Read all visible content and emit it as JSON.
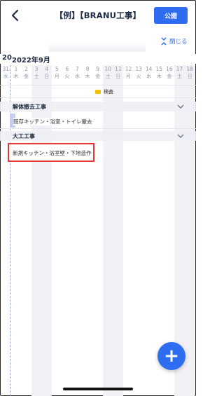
{
  "header": {
    "title": "【例】【BRANU工事】",
    "publish_label": "公開",
    "close_label": "閉じる"
  },
  "calendar": {
    "prev_month_fragment": "20",
    "month_label": "2022年9月",
    "days": [
      {
        "num": "31",
        "wd": "水"
      },
      {
        "num": "1",
        "wd": "木"
      },
      {
        "num": "2",
        "wd": "金"
      },
      {
        "num": "3",
        "wd": "土"
      },
      {
        "num": "4",
        "wd": "日"
      },
      {
        "num": "5",
        "wd": "月"
      },
      {
        "num": "6",
        "wd": "火"
      },
      {
        "num": "7",
        "wd": "水"
      },
      {
        "num": "8",
        "wd": "木"
      },
      {
        "num": "9",
        "wd": "金"
      },
      {
        "num": "10",
        "wd": "土"
      },
      {
        "num": "11",
        "wd": "日"
      },
      {
        "num": "12",
        "wd": "月"
      },
      {
        "num": "13",
        "wd": "火"
      },
      {
        "num": "14",
        "wd": "水"
      },
      {
        "num": "15",
        "wd": "木"
      },
      {
        "num": "16",
        "wd": "金"
      },
      {
        "num": "17",
        "wd": "土"
      },
      {
        "num": "18",
        "wd": "日"
      }
    ],
    "milestone_label": "検査"
  },
  "sections": [
    {
      "label": "解体撤去工事",
      "task": "既存キッチン・浴室・トイレ撤去"
    },
    {
      "label": "大工工事",
      "task": "新規キッチン・浴室壁・下地造作"
    }
  ],
  "fab_label": "+",
  "colors": {
    "accent": "#2f6df0",
    "highlight": "#e53935",
    "milestone": "#f2c200"
  }
}
